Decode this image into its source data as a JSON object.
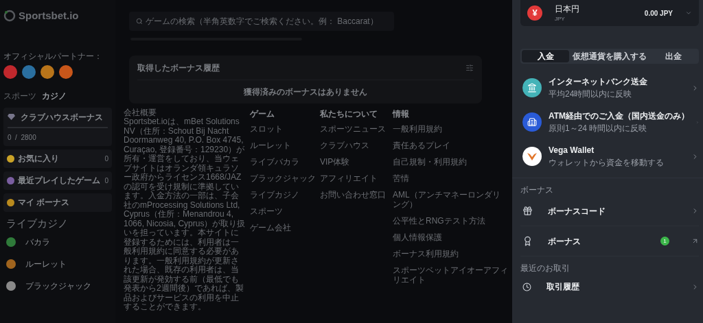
{
  "logo": {
    "text": "Sportsbet.io"
  },
  "partners": {
    "label": "オフィシャルパートナー：",
    "logos": [
      {
        "color": "#c0282d"
      },
      {
        "color": "#2a6fa0"
      },
      {
        "color": "#b8741a"
      },
      {
        "color": "#c8561a"
      }
    ]
  },
  "sidebar": {
    "tabs": [
      {
        "label": "スポーツ",
        "selected": false
      },
      {
        "label": "カジノ",
        "selected": true
      }
    ],
    "clubhouse": {
      "title": "クラブハウスボーナス",
      "progress": "0  /  2800",
      "level": 0
    },
    "items": [
      {
        "label": "お気に入り",
        "count": "0",
        "color": "#c9a227"
      },
      {
        "label": "最近プレイしたゲーム",
        "count": "0",
        "color": "#7a5ea0"
      },
      {
        "label": "マイ ボーナス",
        "color": "#b98a1e"
      }
    ],
    "section": "ライブカジノ",
    "games": [
      {
        "label": "バカラ",
        "color": "#2f7a3a"
      },
      {
        "label": "ルーレット",
        "color": "#a0641e"
      },
      {
        "label": "ブラックジャック",
        "color": "#8a8a8a"
      }
    ]
  },
  "search": {
    "placeholder": "ゲームの検索（半角英数字でご検索ください。例： Baccarat）"
  },
  "bonus_history": {
    "title": "取得したボーナス履歴",
    "empty": "獲得済みのボーナスはありません"
  },
  "footer": {
    "about": {
      "title": "会社概要",
      "text": "Sportsbet.ioは、mBet Solutions NV（住所：Schout Bij Nacht Doormanweg 40, P.O. Box 4745, Curaçao, 登録番号：129230）が所有・運営をしており、当ウェブサイトはオランダ領キュラソー政府からライセンス1668/JAZの認可を受け規制に準拠しています。入金方法の一部は、子会社のmProcessing Solutions Ltd, Cyprus（住所：Menandrou 4, 1066, Nicosia, Cyprus）が取り扱いを担っています。本サイトに登録するためには、利用者は一般利用規約に同意する必要があります。一般利用規約が更新された場合、既存の利用者は、当該更新が発効する前（最低でも発表から2週間後）であれば、製品およびサービスの利用を中止することができます。"
    },
    "columns": [
      {
        "title": "ゲーム",
        "links": [
          "スロット",
          "ルーレット",
          "ライブバカラ",
          "ブラックジャック",
          "ライブカジノ",
          "スポーツ",
          "ゲーム会社"
        ]
      },
      {
        "title": "私たちについて",
        "links": [
          "スポーツニュース",
          "クラブハウス",
          "VIP体験",
          "アフィリエイト",
          "お問い合わせ窓口"
        ]
      },
      {
        "title": "情報",
        "links": [
          "一般利用規約",
          "責任あるプレイ",
          "自己規制・利用規約",
          "苦情",
          "AML（アンチマネーロンダリング）",
          "公平性とRNGテスト方法",
          "個人情報保護",
          "ボーナス利用規約",
          "スポーツベットアイオーアフィリエイト"
        ]
      }
    ]
  },
  "wallet": {
    "currency": {
      "symbol": "¥",
      "name": "日本円",
      "code": "JPY",
      "balance": "0.00 JPY"
    },
    "tabs": [
      {
        "label": "入金",
        "selected": true
      },
      {
        "label": "仮想通貨を購入する",
        "selected": false
      },
      {
        "label": "出金",
        "selected": false
      }
    ],
    "methods": [
      {
        "kind": "bank",
        "title": "インターネットバンク送金",
        "subtitle": "平均24時間以内に反映"
      },
      {
        "kind": "atm",
        "title": "ATM経由でのご入金（国内送金のみ）",
        "subtitle": "原則1～24 時間以内に反映"
      },
      {
        "kind": "vega",
        "title": "Vega Wallet",
        "subtitle": "ウォレットから資金を移動する"
      }
    ],
    "bonus_section": "ボーナス",
    "bonus_items": [
      {
        "kind": "code",
        "label": "ボーナスコード"
      },
      {
        "kind": "bonus",
        "label": "ボーナス",
        "badge": "1"
      }
    ],
    "recent_section": "最近のお取引",
    "recent_items": [
      {
        "label": "取引履歴"
      }
    ]
  }
}
